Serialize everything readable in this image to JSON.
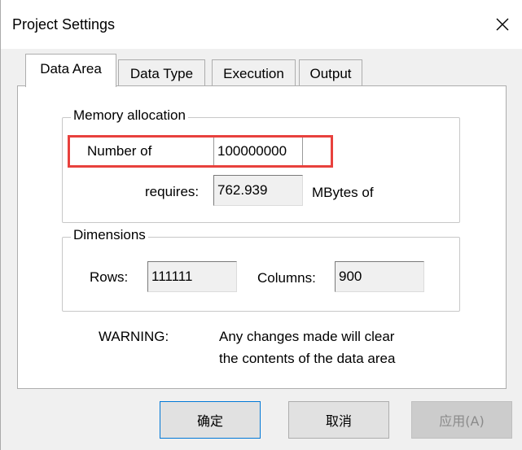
{
  "window": {
    "title": "Project Settings",
    "close_icon": "close-icon"
  },
  "tabs": [
    {
      "label": "Data Area",
      "active": true
    },
    {
      "label": "Data Type",
      "active": false
    },
    {
      "label": "Execution",
      "active": false
    },
    {
      "label": "Output",
      "active": false
    }
  ],
  "memory": {
    "group_title": "Memory allocation",
    "number_label": "Number of",
    "number_value": "100000000",
    "requires_label": "requires:",
    "requires_value": "762.939",
    "unit_label": "MBytes of"
  },
  "dimensions": {
    "group_title": "Dimensions",
    "rows_label": "Rows:",
    "rows_value": "111111",
    "columns_label": "Columns:",
    "columns_value": "900"
  },
  "warning": {
    "label": "WARNING:",
    "line1": "Any changes made will clear",
    "line2": "the contents of the data area"
  },
  "buttons": {
    "ok": "确定",
    "cancel": "取消",
    "apply": "应用(A)"
  },
  "colors": {
    "highlight": "#e8413d",
    "dialog_bg": "#f0f0f0"
  }
}
